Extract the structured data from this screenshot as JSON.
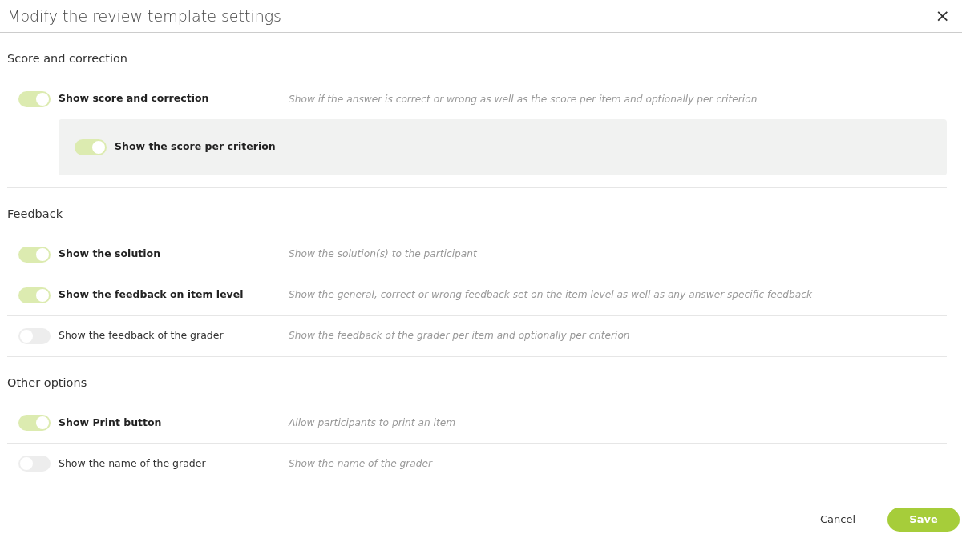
{
  "dialog": {
    "title": "Modify the review template settings",
    "close": "×"
  },
  "sections": [
    {
      "title": "Score and correction",
      "options": [
        {
          "label": "Show score and correction",
          "on": true,
          "description": "Show if the answer is correct or wrong as well as the score per item and optionally per criterion",
          "children": [
            {
              "label": "Show the score per criterion",
              "on": true
            }
          ]
        }
      ]
    },
    {
      "title": "Feedback",
      "options": [
        {
          "label": "Show the solution",
          "on": true,
          "description": "Show the solution(s) to the participant"
        },
        {
          "label": "Show the feedback on item level",
          "on": true,
          "description": "Show the general, correct or wrong feedback set on the item level as well as any answer-specific feedback"
        },
        {
          "label": "Show the feedback of the grader",
          "on": false,
          "description": "Show the feedback of the grader per item and optionally per criterion"
        }
      ]
    },
    {
      "title": "Other options",
      "options": [
        {
          "label": "Show Print button",
          "on": true,
          "description": "Allow participants to print an item"
        },
        {
          "label": "Show the name of the grader",
          "on": false,
          "description": "Show the name of the grader"
        }
      ]
    }
  ],
  "footer": {
    "cancel": "Cancel",
    "save": "Save"
  }
}
